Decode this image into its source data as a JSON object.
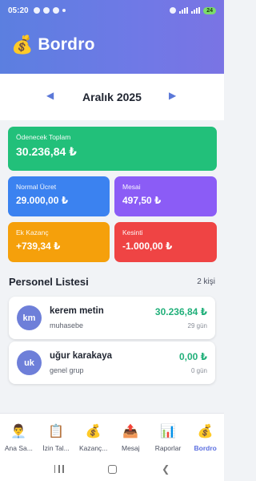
{
  "status_bar": {
    "time": "05:20",
    "battery": "24"
  },
  "app": {
    "title": "Bordro",
    "title_icon": "money-bag-icon"
  },
  "month_selector": {
    "label": "Aralık 2025",
    "prev": "◀",
    "next": "▶"
  },
  "summary": {
    "total": {
      "label": "Ödenecek Toplam",
      "value": "30.236,84 ₺",
      "color": "#22c07a"
    },
    "normal": {
      "label": "Normal Ücret",
      "value": "29.000,00 ₺",
      "color": "#3b82f0"
    },
    "mesai": {
      "label": "Mesai",
      "value": "497,50 ₺",
      "color": "#8b5cf6"
    },
    "ek": {
      "label": "Ek Kazanç",
      "value": "+739,34 ₺",
      "color": "#f5a00b"
    },
    "kesinti": {
      "label": "Kesinti",
      "value": "-1.000,00 ₺",
      "color": "#ef4444"
    }
  },
  "personnel": {
    "title": "Personel Listesi",
    "count": "2 kişi",
    "items": [
      {
        "initials": "km",
        "name": "kerem metin",
        "department": "muhasebe",
        "amount": "30.236,84 ₺",
        "days": "29 gün"
      },
      {
        "initials": "uk",
        "name": "uğur karakaya",
        "department": "genel grup",
        "amount": "0,00 ₺",
        "days": "0 gün"
      }
    ]
  },
  "bottom_nav": [
    {
      "label": "Ana Sa...",
      "icon": "person-icon",
      "glyph": "👨‍💼"
    },
    {
      "label": "İzin Tal...",
      "icon": "clipboard-icon",
      "glyph": "📋"
    },
    {
      "label": "Kazanç...",
      "icon": "money-bag-icon",
      "glyph": "💰"
    },
    {
      "label": "Mesaj",
      "icon": "outbox-icon",
      "glyph": "📤"
    },
    {
      "label": "Raporlar",
      "icon": "chart-icon",
      "glyph": "📊"
    },
    {
      "label": "Bordro",
      "icon": "money-bag-icon",
      "glyph": "💰",
      "active": true
    }
  ]
}
